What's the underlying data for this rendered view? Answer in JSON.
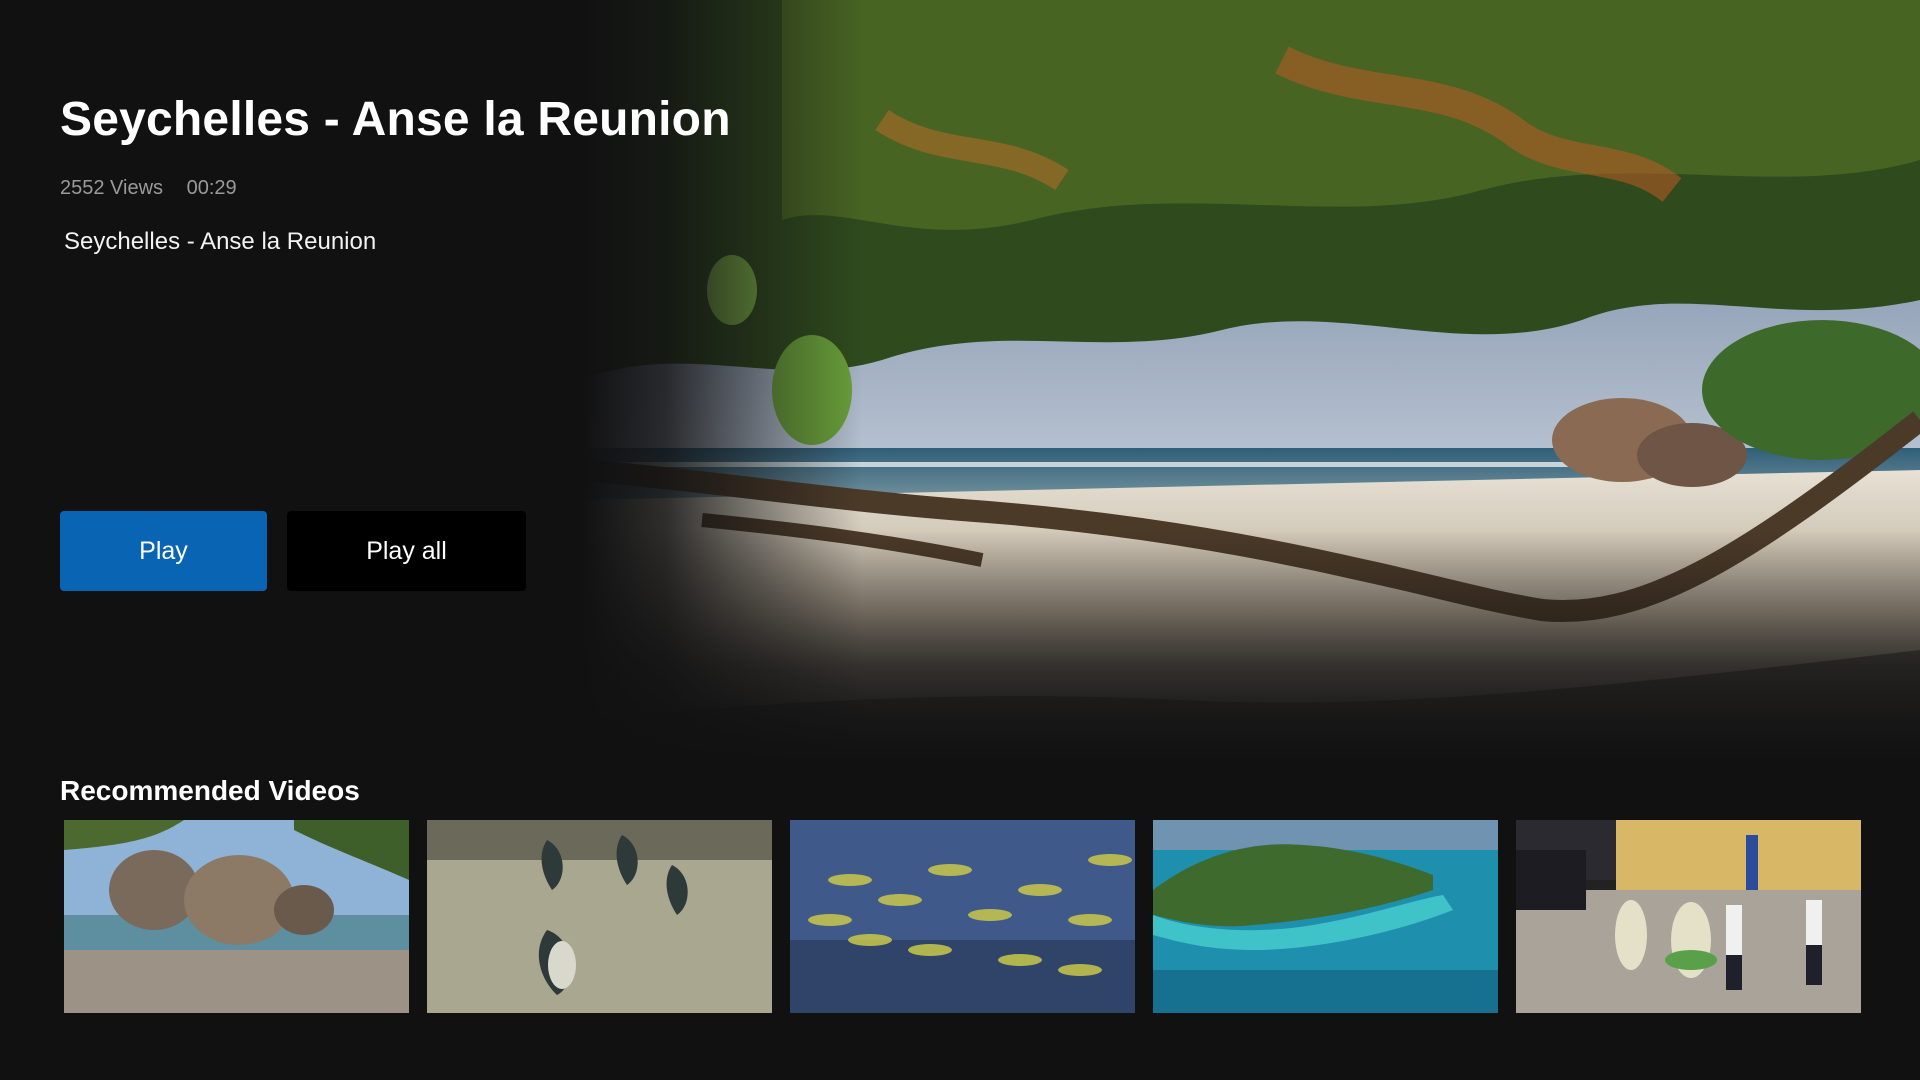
{
  "video": {
    "title": "Seychelles - Anse la Reunion",
    "views": "2552 Views",
    "duration": "00:29",
    "description": "Seychelles - Anse la Reunion"
  },
  "actions": {
    "play_label": "Play",
    "play_all_label": "Play all"
  },
  "recommended": {
    "heading": "Recommended Videos"
  },
  "colors": {
    "background": "#111112",
    "play_button": "#0a64b4",
    "play_all_button": "#000000",
    "meta_text": "#9a9a9a"
  }
}
